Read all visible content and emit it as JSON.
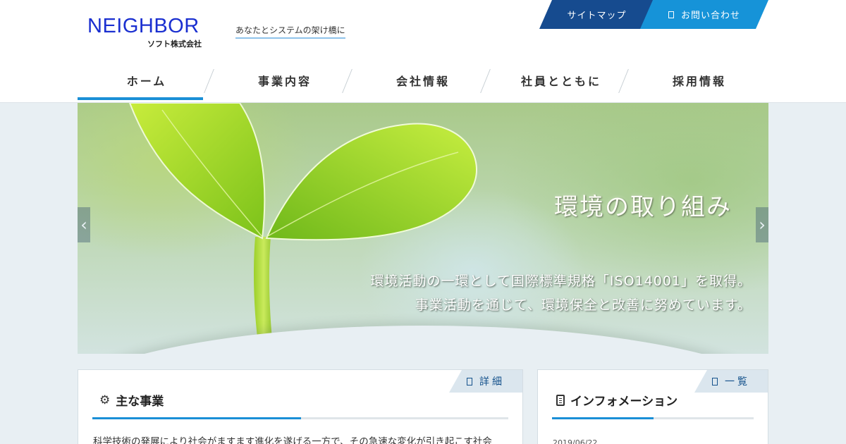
{
  "header": {
    "logo_main": "NEIGHBOR",
    "logo_sub": "ソフト株式会社",
    "tagline": "あなたとシステムの架け橋に",
    "sitemap_label": "サイトマップ",
    "contact_label": "お問い合わせ"
  },
  "nav": {
    "items": [
      {
        "label": "ホーム",
        "active": true
      },
      {
        "label": "事業内容"
      },
      {
        "label": "会社情報"
      },
      {
        "label": "社員とともに"
      },
      {
        "label": "採用情報"
      }
    ]
  },
  "slider": {
    "title": "環境の取り組み",
    "line1": "環境活動の一環として国際標準規格「ISO14001」を取得。",
    "line2": "事業活動を通じて、環境保全と改善に努めています。",
    "prev_icon": "chevron-left-icon",
    "next_icon": "chevron-right-icon"
  },
  "panels": {
    "main": {
      "tab_label": "詳細",
      "heading": "主な事業",
      "text": "科学技術の発展により社会がますます進化を遂げる一方で、その急速な変化が引き起こす社会"
    },
    "info": {
      "tab_label": "一覧",
      "heading": "インフォメーション",
      "date": "2019/06/22"
    }
  },
  "colors": {
    "brand_blue": "#1a2fd0",
    "accent": "#1a8fd6",
    "sitemap_bg": "#164b8f",
    "contact_bg": "#1693d8"
  }
}
